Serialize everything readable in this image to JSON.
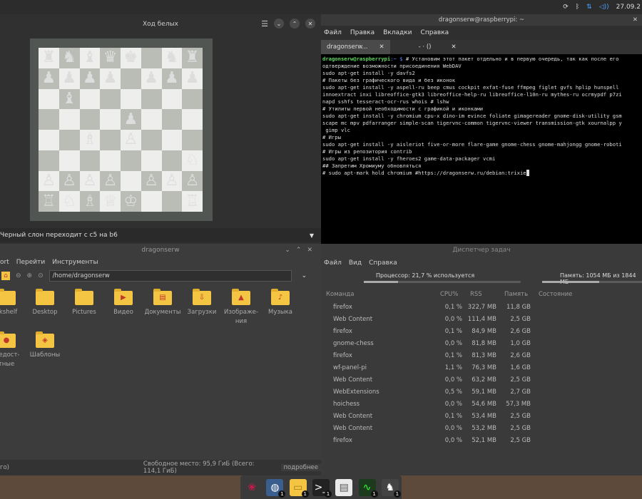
{
  "topbar": {
    "clock": "27.09.2"
  },
  "chess": {
    "title": "Ход белых",
    "status": "Черный слон переходит с c5 на b6",
    "board": [
      [
        "♜",
        "♞",
        "♝",
        "♛",
        "♚",
        "",
        "♞",
        "♜"
      ],
      [
        "♟",
        "♟",
        "♟",
        "♟",
        "",
        "♟",
        "♟",
        "♟"
      ],
      [
        "",
        "♝",
        "",
        "",
        "",
        "",
        "",
        ""
      ],
      [
        "",
        "",
        "",
        "",
        "♟",
        "",
        "",
        ""
      ],
      [
        "",
        "",
        "♗",
        "",
        "♙",
        "",
        "",
        ""
      ],
      [
        "",
        "",
        "",
        "",
        "",
        "",
        "",
        "♘"
      ],
      [
        "♙",
        "♙",
        "♙",
        "♙",
        "",
        "♙",
        "♙",
        "♙"
      ],
      [
        "♖",
        "♘",
        "♗",
        "♕",
        "♔",
        "",
        "",
        "♖"
      ]
    ]
  },
  "terminal": {
    "title": "dragonserw@raspberrypi: ~",
    "menu": [
      "Файл",
      "Правка",
      "Вкладки",
      "Справка"
    ],
    "tabs": [
      "dragonserw...",
      "- · ()"
    ],
    "prompt": "dragonserw@raspberrypi",
    "prompt_path": ":~ $",
    "lines": [
      " # Установим этот пакет отдельно и в первую очередь, так как после его",
      "одтверждение возможности присоединения WebDAV",
      "sudo apt-get install -y davfs2",
      "# Пакеты без графического вида и без иконок",
      "sudo apt-get install -y aspell-ru beep cmus cockpit exfat-fuse ffmpeg figlet gvfs hplip hunspell",
      "innoextract inxi libreoffice-gtk3 libreoffice-help-ru libreoffice-l10n-ru mythes-ru ocrmypdf p7zi",
      "napd sshfs tesseract-ocr-rus whois # lshw",
      "# Утилиты первой необходимости с графикой и иконками",
      "sudo apt-get install -y chromium cpu-x dino-im evince foliate gimagereader gnome-disk-utility gsm",
      "scape mc mpv pdfarranger simple-scan tigervnc-common tigervnc-viewer transmission-gtk xournalpp y",
      " gimp vlc",
      "# Игры",
      "sudo apt-get install -y aisleriot five-or-more flare-game gnome-chess gnome-mahjongg gnome-roboti",
      "# Игры из репозитория contrib",
      "sudo apt-get install -y fheroes2 game-data-packager vcmi",
      "## Запретим Хромиуму обновляться",
      "# sudo apt-mark hold chromium #https://dragonserw.ru/debian:trixie"
    ]
  },
  "filemanager": {
    "title": "dragonserw",
    "menu": [
      "ort",
      "Перейти",
      "Инструменты"
    ],
    "path": "/home/dragonserw",
    "items": [
      {
        "label": "okshelf",
        "glyph": ""
      },
      {
        "label": "Desktop",
        "glyph": ""
      },
      {
        "label": "Pictures",
        "glyph": ""
      },
      {
        "label": "Видео",
        "glyph": "▶"
      },
      {
        "label": "Документы",
        "glyph": "▤"
      },
      {
        "label": "Загрузки",
        "glyph": "⇩"
      },
      {
        "label": "Изображе-ния",
        "glyph": "▲"
      },
      {
        "label": "Музыка",
        "glyph": "♪"
      },
      {
        "label": "щедост-тные",
        "glyph": "●"
      },
      {
        "label": "Шаблоны",
        "glyph": "◈"
      }
    ],
    "status_left": "го)",
    "status_free": "Свободное место: 95,9 ГиБ (Всего: 114,1 ГиБ)",
    "status_right": "подробнее"
  },
  "taskmanager": {
    "title": "Диспетчер задач",
    "menu": [
      "Файл",
      "Вид",
      "Справка"
    ],
    "cpu_label": "Процессор: 21,7 % используется",
    "cpu_fraction": 0.217,
    "mem_label": "Память: 1054 МБ из 1844 МБ",
    "mem_fraction": 0.57,
    "columns": [
      "Команда",
      "CPU%",
      "RSS",
      "Память",
      "Состояние"
    ],
    "rows": [
      [
        "firefox",
        "0,1 %",
        "322,7 MB",
        "11,8 GB",
        ""
      ],
      [
        "Web Content",
        "0,0 %",
        "111,4 MB",
        "2,5 GB",
        ""
      ],
      [
        "firefox",
        "0,1 %",
        "84,9 MB",
        "2,6 GB",
        ""
      ],
      [
        "gnome-chess",
        "0,0 %",
        "81,8 MB",
        "1,0 GB",
        ""
      ],
      [
        "firefox",
        "0,1 %",
        "81,3 MB",
        "2,6 GB",
        ""
      ],
      [
        "wf-panel-pi",
        "1,1 %",
        "76,3 MB",
        "1,6 GB",
        ""
      ],
      [
        "Web Content",
        "0,0 %",
        "63,2 MB",
        "2,5 GB",
        ""
      ],
      [
        "WebExtensions",
        "0,5 %",
        "59,1 MB",
        "2,7 GB",
        ""
      ],
      [
        "hoichess",
        "0,0 %",
        "54,6 MB",
        "57,3 MB",
        ""
      ],
      [
        "Web Content",
        "0,1 %",
        "53,4 MB",
        "2,5 GB",
        ""
      ],
      [
        "Web Content",
        "0,0 %",
        "53,2 MB",
        "2,5 GB",
        ""
      ],
      [
        "firefox",
        "0,0 %",
        "52,1 MB",
        "2,5 GB",
        ""
      ]
    ]
  },
  "dock": {
    "icons": [
      "raspberry-icon",
      "globe-icon",
      "folder-icon",
      "terminal-icon",
      "document-icon",
      "monitor-icon",
      "chess-icon"
    ],
    "badges": [
      "",
      "1",
      "1",
      "1",
      "",
      "1",
      "1"
    ]
  }
}
